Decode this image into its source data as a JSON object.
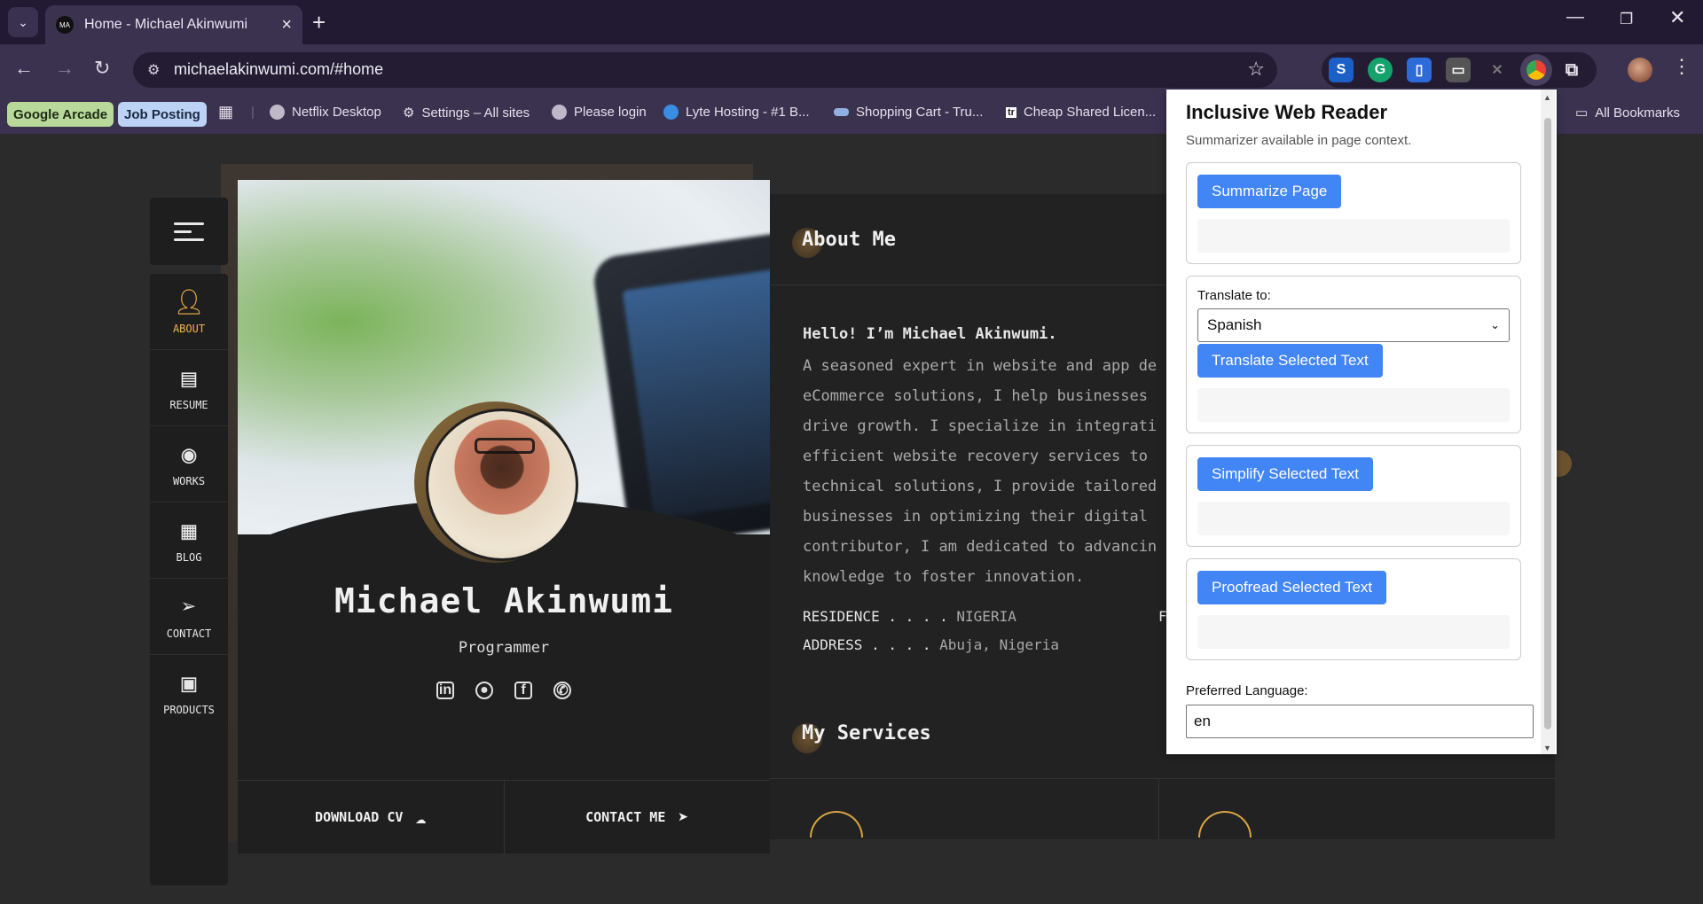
{
  "browser": {
    "tab_title": "Home - Michael Akinwumi",
    "tab_favicon": "MA",
    "url": "michaelakinwumi.com/#home",
    "bookmarks": [
      {
        "label": "Google Arcade"
      },
      {
        "label": "Job Posting"
      },
      {
        "label": "Netflix Desktop"
      },
      {
        "label": "Settings – All sites"
      },
      {
        "label": "Please login"
      },
      {
        "label": "Lyte Hosting - #1 B..."
      },
      {
        "label": "Shopping Cart - Tru..."
      },
      {
        "label": "Cheap Shared Licen..."
      }
    ],
    "all_bookmarks": "All Bookmarks",
    "colors": {
      "frame": "#221a33",
      "toolbar": "#3b3250",
      "chip_green": "#b8d99a",
      "chip_blue": "#bcd3f5"
    }
  },
  "sidenav": {
    "items": [
      {
        "label": "ABOUT",
        "icon": "user-icon"
      },
      {
        "label": "RESUME",
        "icon": "resume-icon"
      },
      {
        "label": "WORKS",
        "icon": "eye-icon"
      },
      {
        "label": "BLOG",
        "icon": "newspaper-icon"
      },
      {
        "label": "CONTACT",
        "icon": "paper-plane-icon"
      },
      {
        "label": "PRODUCTS",
        "icon": "laptop-icon"
      }
    ],
    "active_color": "#f1b34a"
  },
  "profile": {
    "name": "Michael Akinwumi",
    "role": "Programmer",
    "socials": [
      "linkedin-icon",
      "github-icon",
      "facebook-icon",
      "whatsapp-icon"
    ],
    "download_cv": "DOWNLOAD CV",
    "contact_me": "CONTACT ME"
  },
  "about": {
    "title": "About Me",
    "hello": "Hello! I’m Michael Akinwumi.",
    "lines": [
      "A seasoned expert in website and app deve",
      "eCommerce solutions, I help businesses cr",
      "drive growth. I specialize in integrating",
      "efficient website recovery services to pr",
      "technical solutions, I provide tailored t",
      "businesses in optimizing their digital st",
      "contributor, I am dedicated to advancing",
      "knowledge to foster innovation."
    ],
    "residence_label": "RESIDENCE . . . .",
    "residence_value": "NIGERIA",
    "address_label": "ADDRESS . . . .",
    "address_value": "Abuja, Nigeria",
    "clipped_letter": "F"
  },
  "services": {
    "title": "My Services"
  },
  "popup": {
    "title": "Inclusive Web Reader",
    "subtitle": "Summarizer available in page context.",
    "summarize_label": "Summarize Page",
    "translate_to_label": "Translate to:",
    "translate_selected": "Spanish",
    "translate_button": "Translate Selected Text",
    "simplify_button": "Simplify Selected Text",
    "proofread_button": "Proofread Selected Text",
    "preferred_language_label": "Preferred Language:",
    "preferred_language_value": "en",
    "accent": "#4285f4"
  }
}
